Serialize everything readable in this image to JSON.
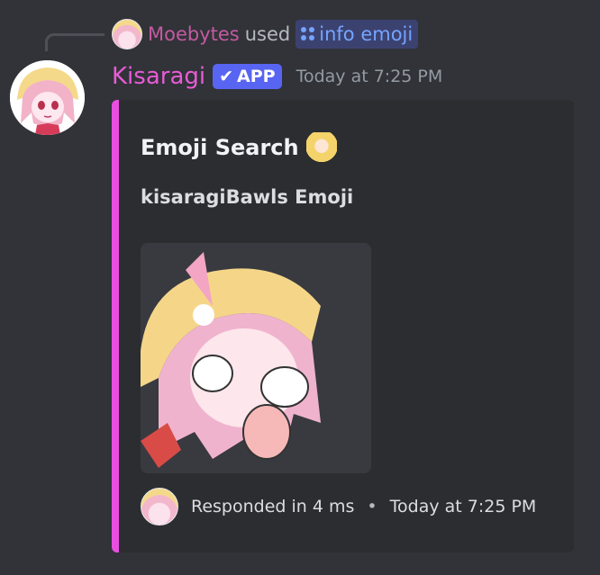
{
  "reply": {
    "username": "Moebytes",
    "used_text": "used",
    "command": "info emoji"
  },
  "author": {
    "name": "Kisaragi",
    "badge": "APP",
    "timestamp": "Today at 7:25 PM"
  },
  "embed": {
    "title": "Emoji Search",
    "description": "kisaragiBawls Emoji",
    "footer_text": "Responded in 4 ms",
    "footer_separator": "•",
    "footer_timestamp": "Today at 7:25 PM",
    "accent_color": "#e84fe0"
  },
  "colors": {
    "background": "#313338",
    "embed_background": "#2b2d31",
    "username": "#e85bd7",
    "reply_username": "#c45aa0",
    "command": "#74a4ff",
    "app_badge": "#5865f2"
  },
  "icons": {
    "command": "slash-command-icon",
    "badge_check": "checkmark-icon",
    "title_emoji": "emoji-icon"
  }
}
